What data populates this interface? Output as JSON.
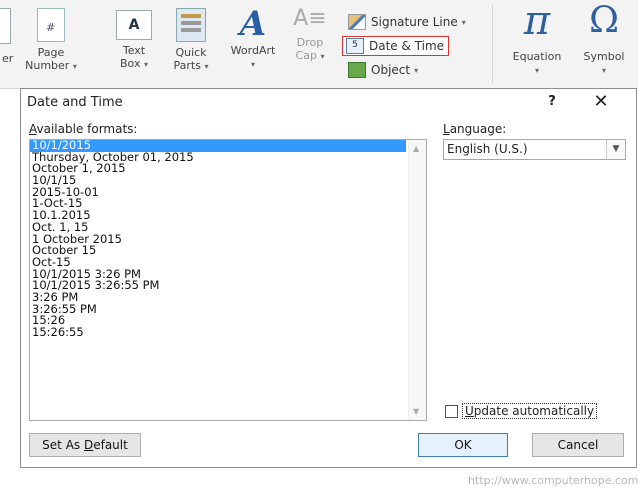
{
  "ribbon": {
    "partial_left_label": "er",
    "page_number": {
      "line1": "Page",
      "line2": "Number"
    },
    "text_box": {
      "line1": "Text",
      "line2": "Box"
    },
    "quick_parts": {
      "line1": "Quick",
      "line2": "Parts"
    },
    "wordart": {
      "label": "WordArt",
      "glyph": "A"
    },
    "drop_cap": {
      "line1": "Drop",
      "line2": "Cap"
    },
    "signature_line": "Signature Line",
    "date_time": "Date & Time",
    "object": "Object",
    "equation": {
      "label": "Equation",
      "glyph": "π"
    },
    "symbol": {
      "label": "Symbol",
      "glyph": "Ω"
    },
    "dropdown_arrow": "▾"
  },
  "dialog": {
    "title": "Date and Time",
    "help": "?",
    "close": "✕",
    "available_formats_label_prefix": "",
    "available_formats_label_u": "A",
    "available_formats_label_rest": "vailable formats:",
    "language_label_u": "L",
    "language_label_rest": "anguage:",
    "language_value": "English (U.S.)",
    "formats": [
      "10/1/2015",
      "Thursday, October 01, 2015",
      "October 1, 2015",
      "10/1/15",
      "2015-10-01",
      "1-Oct-15",
      "10.1.2015",
      "Oct. 1, 15",
      "1 October 2015",
      "October 15",
      "Oct-15",
      "10/1/2015 3:26 PM",
      "10/1/2015 3:26:55 PM",
      "3:26 PM",
      "3:26:55 PM",
      "15:26",
      "15:26:55"
    ],
    "selected_index": 0,
    "update_u": "U",
    "update_rest": "pdate automatically",
    "update_checked": false,
    "set_default_pre": "Set As ",
    "set_default_u": "D",
    "set_default_post": "efault",
    "ok_label": "OK",
    "cancel_label": "Cancel"
  },
  "watermark": "http://www.computerhope.com",
  "colors": {
    "selection": "#3399ff",
    "accent_icon": "#2f5f9f",
    "highlight_border": "#dd3333"
  }
}
